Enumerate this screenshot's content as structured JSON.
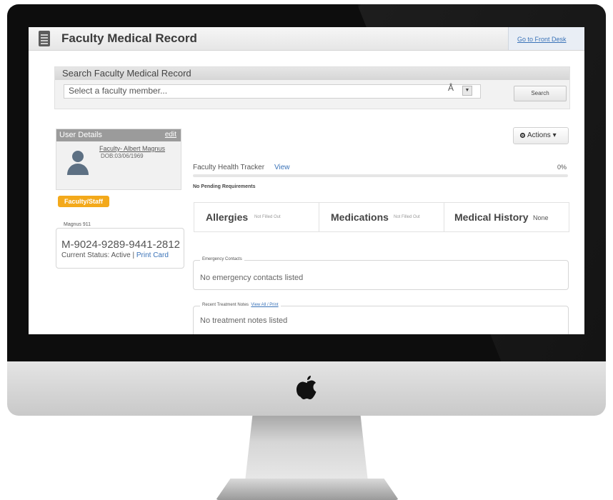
{
  "app": {
    "title": "Faculty Medical Record",
    "front_desk_link": "Go to Front Desk"
  },
  "search": {
    "heading": "Search Faculty Medical Record",
    "placeholder": "Select a faculty member...",
    "a_glyph": "Å",
    "button_label": "Search"
  },
  "user": {
    "header": "User Details",
    "edit_link": "edit",
    "name": "Faculty- Albert Magnus",
    "dob": "DOB:03/06/1969",
    "role_badge": "Faculty/Staff"
  },
  "card": {
    "legend": "Magnus 911",
    "number": "M-9024-9289-9441-2812",
    "status": "Current Status: Active",
    "separator": " | ",
    "print_link": "Print Card"
  },
  "actions": {
    "label": "Actions ▾"
  },
  "tracker": {
    "label": "Faculty Health Tracker",
    "view_link": "View",
    "percent_text": "0%",
    "progress": 0,
    "pending": "No Pending Requirements"
  },
  "tiles": [
    {
      "title": "Allergies",
      "status": "Not Filled Out"
    },
    {
      "title": "Medications",
      "status": "Not Filled Out"
    },
    {
      "title": "Medical History",
      "status": "None"
    }
  ],
  "emergency": {
    "legend": "Emergency Contacts",
    "text": "No emergency contacts listed"
  },
  "treatment": {
    "legend": "Recent Treatment Notes",
    "link": "View All / Print",
    "text": "No treatment notes listed"
  },
  "icons": [
    "document-icon",
    "user-avatar-icon",
    "gear-icon",
    "chevron-down-icon",
    "apple-logo-icon"
  ],
  "colors": {
    "link": "#3a73b8",
    "badge": "#f3a91b",
    "bezel": "#0d0d0d"
  }
}
